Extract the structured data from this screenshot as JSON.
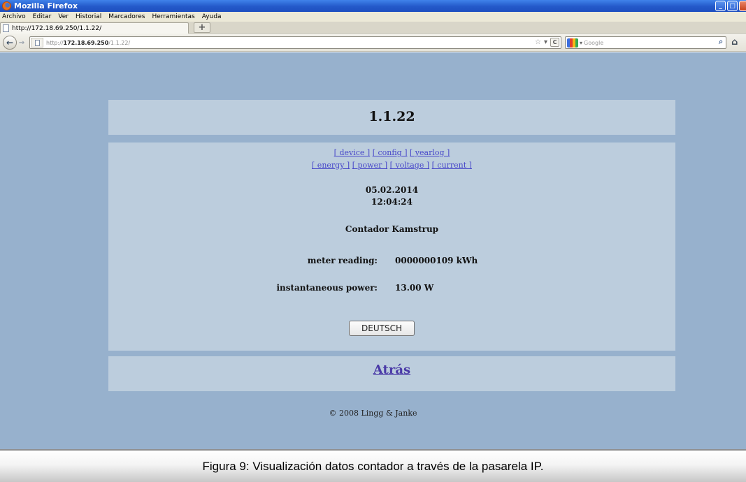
{
  "window": {
    "title": "Mozilla Firefox",
    "controls": [
      "_",
      "□",
      "×"
    ]
  },
  "menu": {
    "items": [
      "Archivo",
      "Editar",
      "Ver",
      "Historial",
      "Marcadores",
      "Herramientas",
      "Ayuda"
    ]
  },
  "tabs": [
    {
      "label": "http://172.18.69.250/1.1.22/"
    }
  ],
  "newtab_label": "+",
  "nav": {
    "back_glyph": "←",
    "forward_glyph": "→",
    "url_prefix": "http://",
    "url_host": "172.18.69.250",
    "url_path": "/1.1.22/",
    "reload_glyph": "C",
    "search_placeholder": "Google",
    "search_icon": "magnifier-icon",
    "home_icon": "home-icon"
  },
  "page": {
    "title": "1.1.22",
    "links_row1": [
      "[ device ]",
      "[ config ]",
      "[ yearlog ]"
    ],
    "links_row2": [
      "[ energy ]",
      "[ power ]",
      "[ voltage ]",
      "[ current ]"
    ],
    "date": "05.02.2014",
    "time": "12:04:24",
    "meter_title": "Contador Kamstrup",
    "meter_reading_label": "meter reading:",
    "meter_reading_value": "0000000109 kWh",
    "power_label": "instantaneous power:",
    "power_value": "13.00 W",
    "language_button": "DEUTSCH",
    "back_link": "Atrás",
    "copyright": "© 2008 Lingg & Janke"
  },
  "caption": "Figura 9: Visualización datos contador a través de la pasarela IP.",
  "colors": {
    "titlebar": "#2459c9",
    "page_background": "#97b1cd",
    "panel_background": "#bccddd",
    "link": "#4747c9"
  }
}
